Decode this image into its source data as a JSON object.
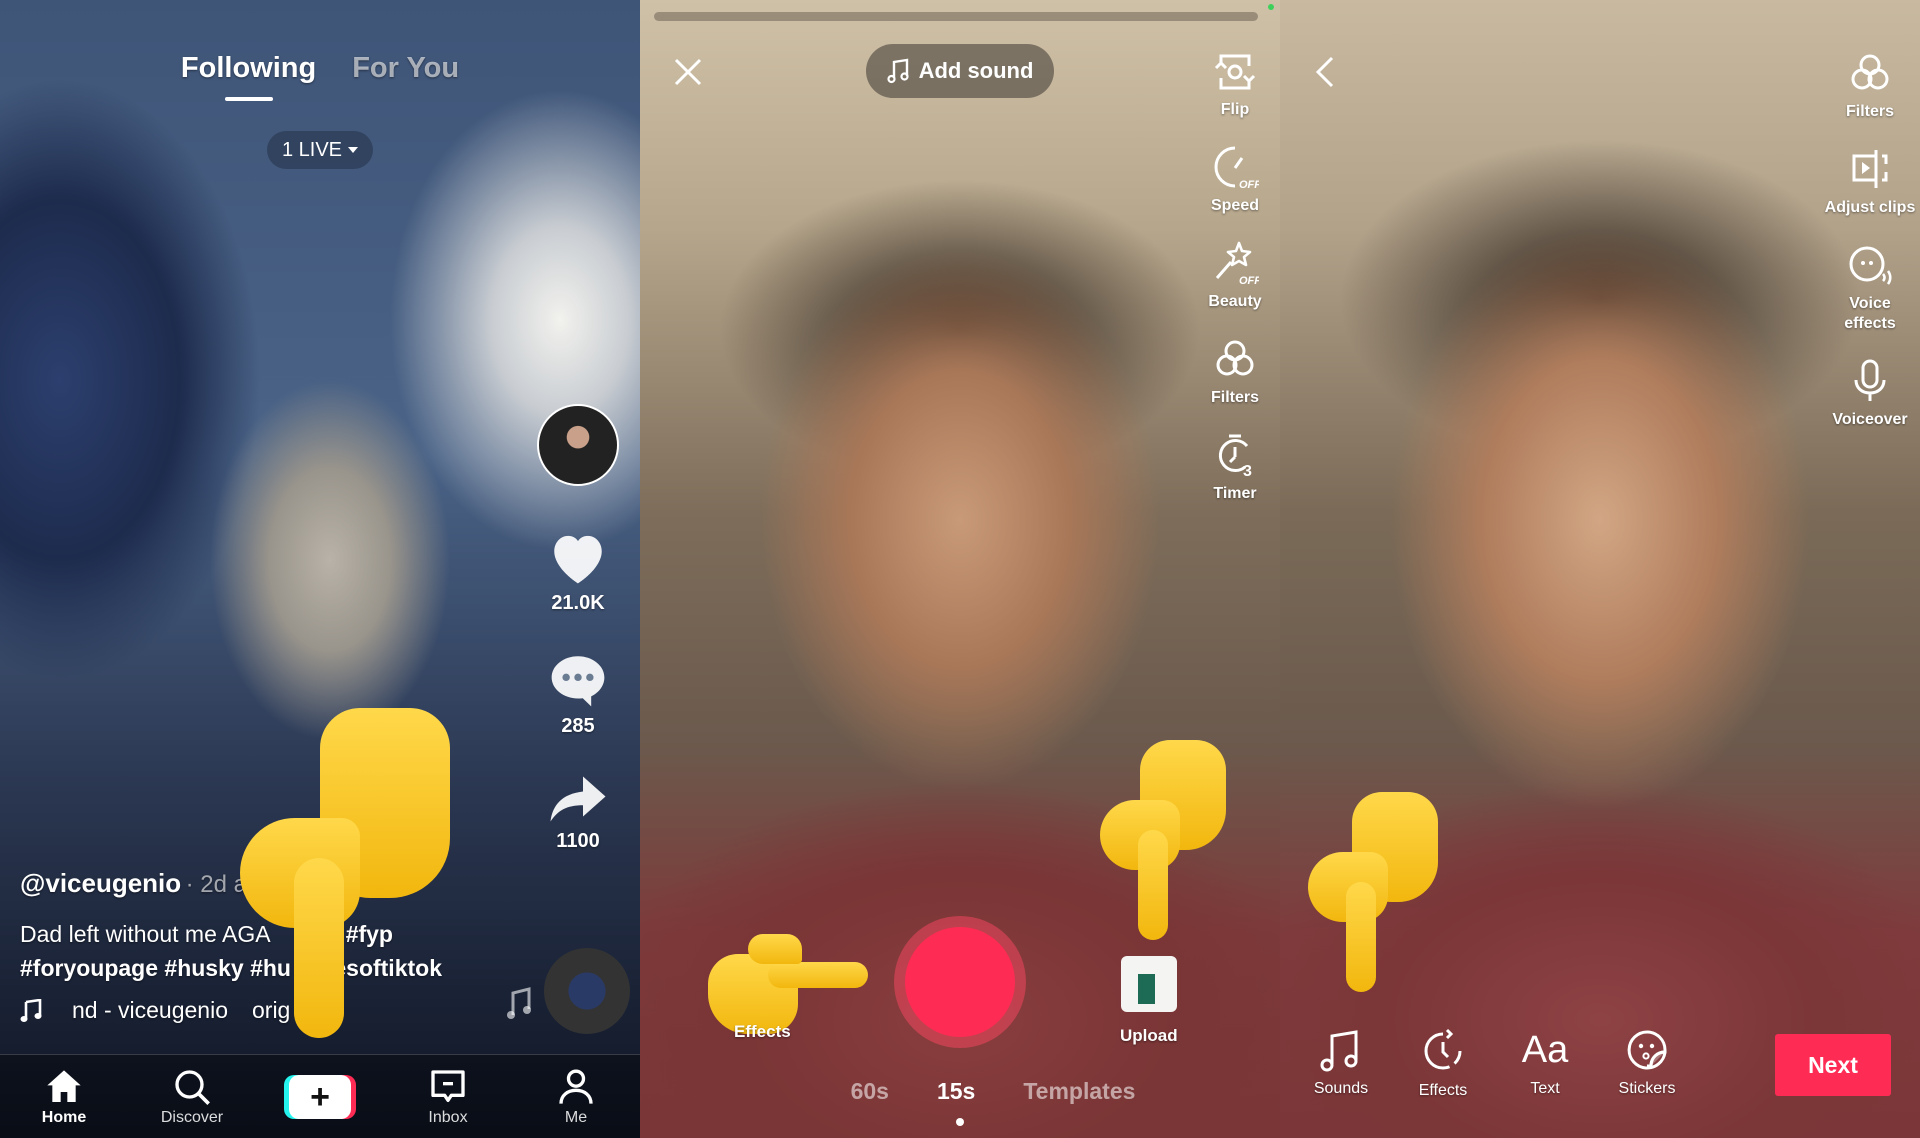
{
  "feed": {
    "tabs": [
      {
        "label": "Following",
        "active": true
      },
      {
        "label": "For You",
        "active": false
      }
    ],
    "live_pill": "1 LIVE",
    "actions": {
      "likes": "21.0K",
      "comments": "285",
      "shares": "1100"
    },
    "post": {
      "username": "@viceugenio",
      "time": "· 2d a",
      "description_line1": "Dad left without me AGA",
      "description_tag1": "#fyp",
      "description_line2": "#foryoupage #husky #hu",
      "description_line2_end": "esoftiktok",
      "music": "nd - viceugenio",
      "music_end": "orig"
    },
    "nav": [
      {
        "label": "Home",
        "icon": "home-icon",
        "active": true
      },
      {
        "label": "Discover",
        "icon": "search-icon",
        "active": false
      },
      {
        "label": "",
        "icon": "plus-icon",
        "active": false
      },
      {
        "label": "Inbox",
        "icon": "inbox-icon",
        "active": false
      },
      {
        "label": "Me",
        "icon": "profile-icon",
        "active": false
      }
    ],
    "create_symbol": "+"
  },
  "camera": {
    "add_sound": "Add sound",
    "tools": [
      {
        "label": "Flip",
        "icon": "flip-camera-icon"
      },
      {
        "label": "Speed",
        "icon": "speed-icon",
        "badge": "OFF"
      },
      {
        "label": "Beauty",
        "icon": "beauty-wand-icon",
        "badge": "OFF"
      },
      {
        "label": "Filters",
        "icon": "filters-icon"
      },
      {
        "label": "Timer",
        "icon": "timer-icon",
        "badge": "3"
      }
    ],
    "effects_label": "Effects",
    "upload_label": "Upload",
    "modes": [
      {
        "label": "60s",
        "active": false
      },
      {
        "label": "15s",
        "active": true
      },
      {
        "label": "Templates",
        "active": false
      }
    ],
    "record_color": "#fe2c55"
  },
  "editor": {
    "tools": [
      {
        "label": "Filters",
        "icon": "filters-icon"
      },
      {
        "label": "Adjust clips",
        "icon": "adjust-clips-icon"
      },
      {
        "label": "Voice effects",
        "icon": "voice-effects-icon"
      },
      {
        "label": "Voiceover",
        "icon": "microphone-icon"
      }
    ],
    "bottom": [
      {
        "label": "Sounds",
        "icon": "music-note-icon"
      },
      {
        "label": "Effects",
        "icon": "effects-clock-icon"
      },
      {
        "label": "Text",
        "icon": "text-icon",
        "glyph": "Aa"
      },
      {
        "label": "Stickers",
        "icon": "sticker-icon"
      }
    ],
    "next_label": "Next",
    "accent": "#fe2c55"
  }
}
